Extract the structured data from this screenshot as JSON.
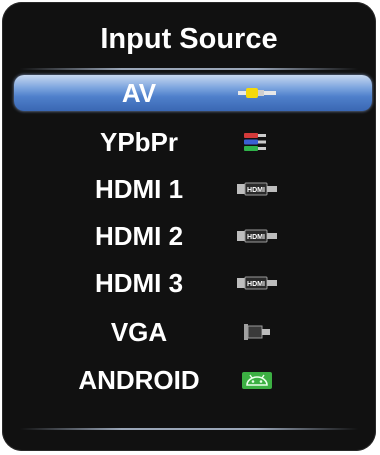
{
  "menu": {
    "title": "Input Source",
    "items": [
      {
        "label": "AV",
        "icon": "composite-av-icon",
        "selected": true
      },
      {
        "label": "YPbPr",
        "icon": "component-ypbpr-icon",
        "selected": false
      },
      {
        "label": "HDMI 1",
        "icon": "hdmi-icon",
        "icon_text": "HDMI",
        "selected": false
      },
      {
        "label": "HDMI 2",
        "icon": "hdmi-icon",
        "icon_text": "HDMI",
        "selected": false
      },
      {
        "label": "HDMI 3",
        "icon": "hdmi-icon",
        "icon_text": "HDMI",
        "selected": false
      },
      {
        "label": "VGA",
        "icon": "vga-icon",
        "selected": false
      },
      {
        "label": "ANDROID",
        "icon": "android-icon",
        "selected": false
      }
    ]
  },
  "colors": {
    "panel_background": "#111111",
    "highlight": "#4f80cb",
    "text": "#ffffff",
    "android_green": "#3cb043"
  }
}
